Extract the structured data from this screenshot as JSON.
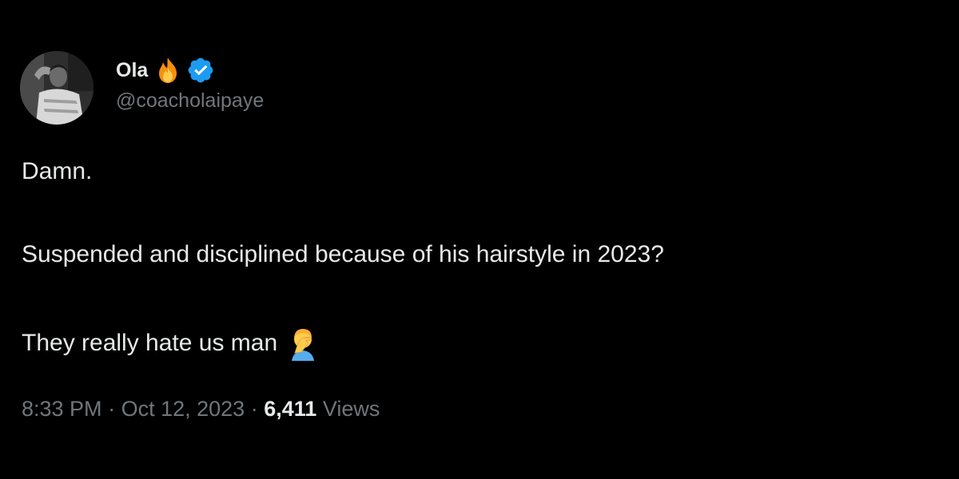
{
  "author": {
    "display_name": "Ola",
    "handle": "@coacholaipaye",
    "badges": [
      "fire-icon",
      "verified-icon"
    ],
    "verified_color": "#1d9bf0"
  },
  "tweet": {
    "lines": [
      "Damn.",
      "Suspended and disciplined because of his hairstyle in 2023?",
      "They really hate us man"
    ],
    "trailing_emoji": "facepalm-icon"
  },
  "meta": {
    "time": "8:33 PM",
    "separator": "·",
    "date": "Oct 12, 2023",
    "views_count": "6,411",
    "views_label": "Views"
  },
  "colors": {
    "background": "#000000",
    "primary_text": "#e7e9ea",
    "secondary_text": "#71767b"
  }
}
